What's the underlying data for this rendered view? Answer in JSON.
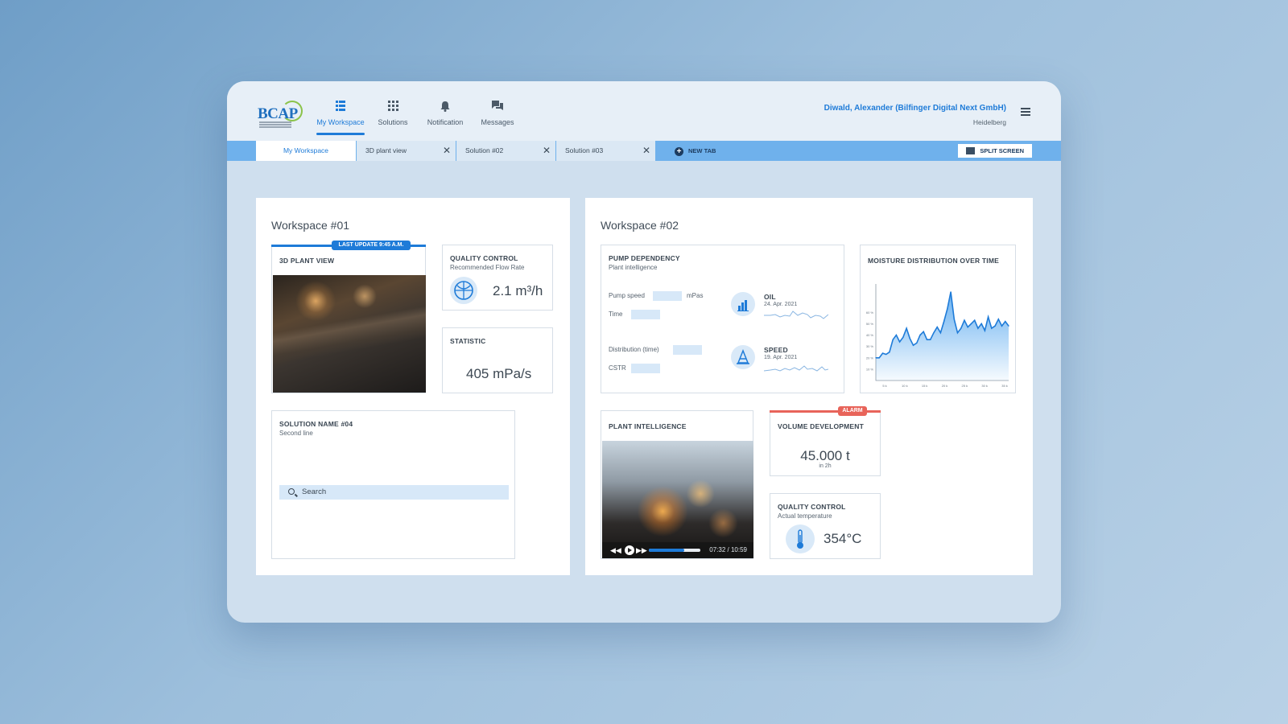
{
  "header": {
    "logo_text": "BCAP",
    "nav": [
      {
        "label": "My Workspace",
        "icon": "workspace-icon",
        "active": true
      },
      {
        "label": "Solutions",
        "icon": "grid-icon"
      },
      {
        "label": "Notification",
        "icon": "bell-icon"
      },
      {
        "label": "Messages",
        "icon": "chat-icon"
      }
    ],
    "user_name": "Diwald, Alexander (Bilfinger Digital Next GmbH)",
    "user_location": "Heidelberg",
    "menu_icon": "hamburger-icon"
  },
  "tabs": [
    {
      "label": "My Workspace",
      "active": true
    },
    {
      "label": "3D plant view"
    },
    {
      "label": "Solution #02"
    },
    {
      "label": "Solution #03"
    }
  ],
  "new_tab_label": "NEW TAB",
  "split_label": "SPLIT SCREEN",
  "workspace1": {
    "title": "Workspace #01",
    "plant_view": {
      "title": "3D PLANT VIEW",
      "badge": "LAST UPDATE 9:45 A.M."
    },
    "quality_control": {
      "title": "QUALITY CONTROL",
      "subtitle": "Recommended Flow Rate",
      "value": "2.1 m³/h",
      "icon": "gauge-icon"
    },
    "statistic": {
      "title": "STATISTIC",
      "value": "405 mPa/s"
    },
    "solution": {
      "title": "SOLUTION NAME #04",
      "subtitle": "Second line",
      "search_placeholder": "Search"
    }
  },
  "workspace2": {
    "title": "Workspace #02",
    "pump": {
      "title": "PUMP DEPENDENCY",
      "subtitle": "Plant intelligence",
      "fields": {
        "pump_speed": "Pump speed",
        "unit": "mPas",
        "time": "Time",
        "distribution": "Distribution (time)",
        "cstr": "CSTR"
      },
      "oil": {
        "label": "OIL",
        "date": "24. Apr. 2021",
        "icon": "bar-chart-icon"
      },
      "speed": {
        "label": "SPEED",
        "date": "19. Apr. 2021",
        "icon": "cone-icon"
      }
    },
    "moisture": {
      "title": "MOISTURE DISTRIBUTION OVER TIME"
    },
    "plant_intelligence": {
      "title": "PLANT INTELLIGENCE",
      "time": "07:32 / 10:59",
      "progress": 0.69
    },
    "volume": {
      "title": "VOLUME DEVELOPMENT",
      "badge": "ALARM",
      "value": "45.000 t",
      "sub": "in 2h"
    },
    "quality_control": {
      "title": "QUALITY CONTROL",
      "subtitle": "Actual temperature",
      "value": "354°C",
      "icon": "thermometer-icon"
    }
  },
  "colors": {
    "accent": "#1e7bd8",
    "alarm": "#e8645a",
    "tabbar": "#6fb1ec"
  },
  "chart_data": {
    "type": "area",
    "title": "MOISTURE DISTRIBUTION OVER TIME",
    "x": [
      0,
      1,
      2,
      3,
      4,
      5,
      6,
      7,
      8,
      9,
      10,
      11,
      12,
      13,
      14,
      15,
      16,
      17,
      18,
      19,
      20,
      21,
      22,
      23,
      24,
      25,
      26,
      27,
      28,
      29,
      30,
      31,
      32,
      33,
      34,
      35,
      36,
      37,
      38,
      39
    ],
    "values": [
      20,
      20,
      24,
      23,
      25,
      36,
      40,
      34,
      38,
      46,
      37,
      31,
      33,
      40,
      43,
      36,
      36,
      42,
      47,
      42,
      52,
      63,
      78,
      54,
      42,
      46,
      53,
      47,
      50,
      53,
      46,
      50,
      44,
      56,
      46,
      48,
      54,
      48,
      52,
      48
    ],
    "yticks": [
      "10 %",
      "20 %",
      "30 %",
      "40 %",
      "50 %",
      "60 %"
    ],
    "xticks": [
      "5 k",
      "10 k",
      "15 k",
      "20 k",
      "25 k",
      "30 k",
      "35 k"
    ],
    "ylim": [
      0,
      85
    ]
  }
}
